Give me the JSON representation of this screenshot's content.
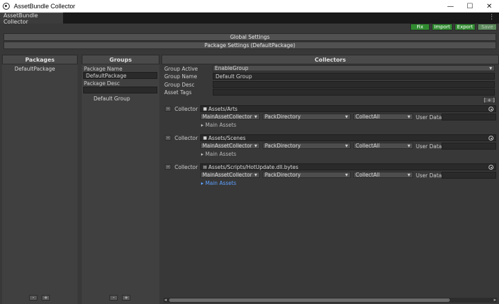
{
  "window": {
    "title": "AssetBundle Collector",
    "minimize": "—",
    "maximize": "☐",
    "close": "✕"
  },
  "tab": {
    "label": "AssetBundle Collector",
    "menu": "⋮"
  },
  "toolbar": {
    "fix": "Fix",
    "import": "Import",
    "export": "Export",
    "save": "Save"
  },
  "settings": {
    "global": "Global Settings",
    "package": "Package Settings (DefaultPackage)"
  },
  "packages": {
    "header": "Packages",
    "items": [
      "DefaultPackage"
    ],
    "minus": "-",
    "plus": "+"
  },
  "groups": {
    "header": "Groups",
    "package_name_label": "Package Name",
    "package_name_value": "DefaultPackage",
    "package_desc_label": "Package Desc",
    "package_desc_value": "",
    "items": [
      "Default Group"
    ],
    "minus": "-",
    "plus": "+"
  },
  "collectors": {
    "header": "Collectors",
    "group_active_label": "Group Active",
    "group_active_value": "EnableGroup",
    "group_name_label": "Group Name",
    "group_name_value": "Default Group",
    "group_desc_label": "Group Desc",
    "group_desc_value": "",
    "asset_tags_label": "Asset Tags",
    "asset_tags_value": "",
    "add_label": "[ + ]",
    "collector_label": "Collector",
    "user_data_label": "User Data",
    "main_assets_label": "Main Assets",
    "items": [
      {
        "path": "Assets/Arts",
        "collector_type": "MainAssetCollector",
        "pack_rule": "PackDirectory",
        "filter_rule": "CollectAll",
        "user_data": "",
        "icon": "folder-icon"
      },
      {
        "path": "Assets/Scenes",
        "collector_type": "MainAssetCollector",
        "pack_rule": "PackDirectory",
        "filter_rule": "CollectAll",
        "user_data": "",
        "icon": "folder-icon"
      },
      {
        "path": "Assets/Scripts/HotUpdate.dll.bytes",
        "collector_type": "MainAssetCollector",
        "pack_rule": "PackDirectory",
        "filter_rule": "CollectAll",
        "user_data": "",
        "icon": "file-icon"
      }
    ]
  },
  "colors": {
    "accent_green": "#2f8a2f",
    "link_blue": "#5ea0ff",
    "panel_bg": "#383838"
  }
}
